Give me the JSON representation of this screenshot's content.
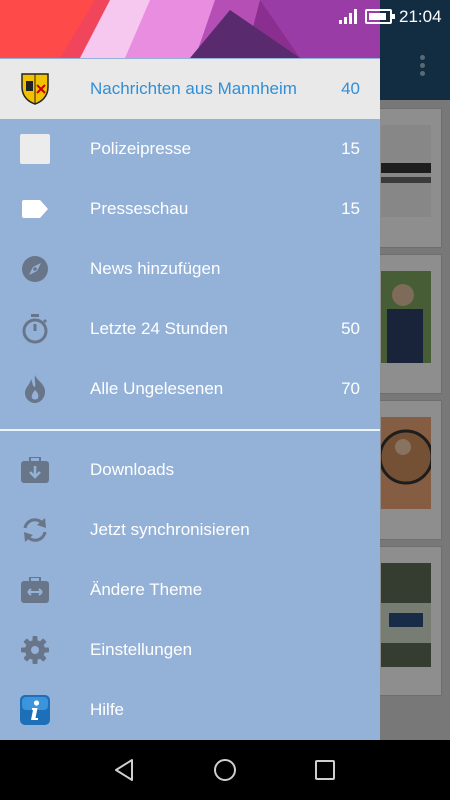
{
  "status_bar": {
    "time": "21:04",
    "icons": [
      "signal-icon",
      "battery-icon"
    ]
  },
  "drawer": {
    "top_items": [
      {
        "label": "Nachrichten aus Mannheim",
        "count": "40",
        "icon": "coat-of-arms-icon",
        "active": true
      },
      {
        "label": "Polizeipresse",
        "count": "15",
        "icon": "blank-square-icon"
      },
      {
        "label": "Presseschau",
        "count": "15",
        "icon": "tag-icon"
      },
      {
        "label": "News hinzufügen",
        "count": "",
        "icon": "compass-icon"
      },
      {
        "label": "Letzte 24 Stunden",
        "count": "50",
        "icon": "stopwatch-icon"
      },
      {
        "label": "Alle Ungelesenen",
        "count": "70",
        "icon": "flame-icon"
      }
    ],
    "bottom_items": [
      {
        "label": "Downloads",
        "icon": "download-box-icon"
      },
      {
        "label": "Jetzt synchronisieren",
        "icon": "sync-icon"
      },
      {
        "label": "Ändere Theme",
        "icon": "theme-box-icon"
      },
      {
        "label": "Einstellungen",
        "icon": "gear-icon"
      },
      {
        "label": "Hilfe",
        "icon": "info-icon"
      }
    ]
  },
  "nav_bar": {
    "buttons": [
      "back-icon",
      "home-icon",
      "recents-icon"
    ]
  },
  "colors": {
    "drawer_bg": "#94b2d8",
    "active_text": "#2f8fd8",
    "active_bg": "#e9e9e9",
    "toolbar": "#1f4f73"
  }
}
